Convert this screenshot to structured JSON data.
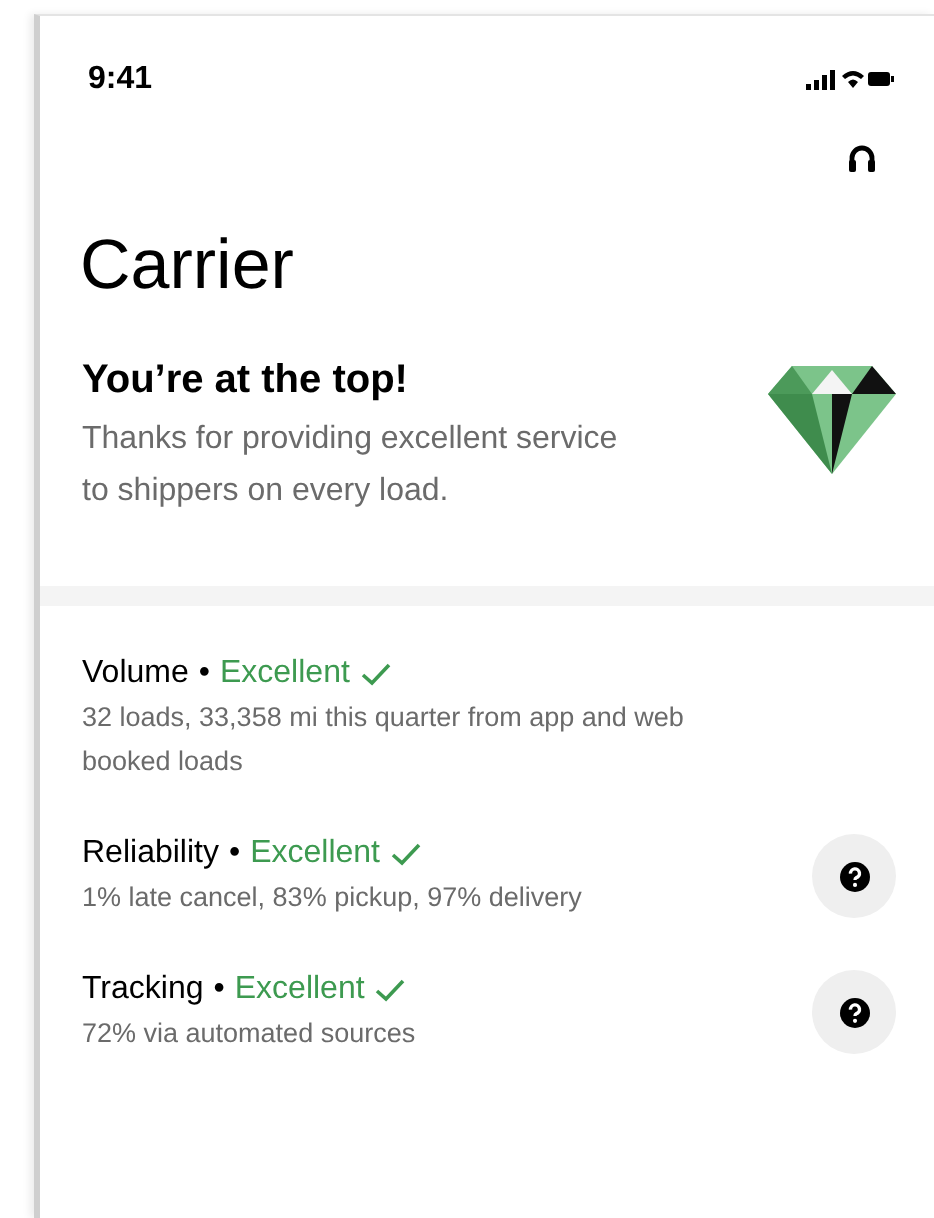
{
  "status_bar": {
    "time": "9:41"
  },
  "title": "Carrier",
  "banner": {
    "heading": "You’re at the top!",
    "text": "Thanks for providing excellent service to shippers on every load."
  },
  "metrics": [
    {
      "name": "Volume",
      "separator": "•",
      "rating": "Excellent",
      "detail": "32 loads, 33,358 mi this quarter from app and web booked loads",
      "help": false
    },
    {
      "name": "Reliability",
      "separator": "•",
      "rating": "Excellent",
      "detail": "1% late cancel, 83% pickup, 97% delivery",
      "help": true
    },
    {
      "name": "Tracking",
      "separator": "•",
      "rating": "Excellent",
      "detail": "72% via automated sources",
      "help": true
    }
  ]
}
